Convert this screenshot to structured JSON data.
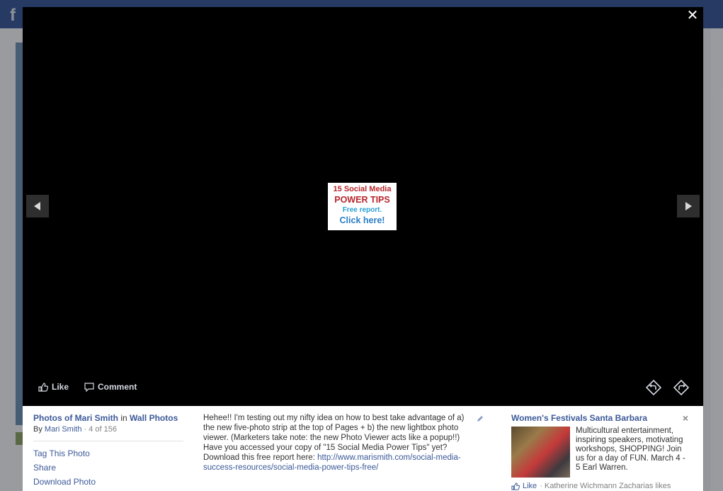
{
  "background": {
    "logo": "f"
  },
  "viewer": {
    "close_icon": "close-icon",
    "prev_icon": "arrow-left-icon",
    "next_icon": "arrow-right-icon",
    "photo": {
      "line1": "15 Social Media",
      "line2": "POWER TIPS",
      "line3": "Free report.",
      "line4": "Click here!",
      "colors": {
        "red": "#b8262b",
        "blue": "#2a7ec8"
      }
    },
    "actions": {
      "like": "Like",
      "comment": "Comment"
    }
  },
  "info": {
    "album_prefix": "Photos of Mari Smith",
    "album_in": "in",
    "album_name": "Wall Photos",
    "by_label": "By",
    "owner": "Mari Smith",
    "position": "· 4 of 156",
    "menu": [
      "Tag This Photo",
      "Share",
      "Download Photo"
    ],
    "caption_p1": "Heheе!! I'm testing out my nifty idea on how to best take advantage of a) the new five-photo strip at the top of Pages + b) the new lightbox photo viewer. (Marketers take note: the new Photo Viewer acts like a popup!!)",
    "caption_p2": "Have you accessed your copy of \"15 Social Media Power Tips\" yet?",
    "caption_p3_prefix": "Download this free report here:",
    "caption_link": "http://www.marismith.com/social-media-success-resources/social-media-power-tips-free/"
  },
  "ad": {
    "title": "Women's Festivals Santa Barbara",
    "close": "×",
    "text": "Multicultural entertainment, inspiring speakers, motivating workshops, SHOPPING! Join us for a day of FUN. March 4 - 5 Earl Warren.",
    "like_label": "Like",
    "like_text": "· Katherine Wichmann Zacharias likes"
  },
  "colors": {
    "fb_blue": "#3b5998",
    "link": "#3b5998"
  }
}
